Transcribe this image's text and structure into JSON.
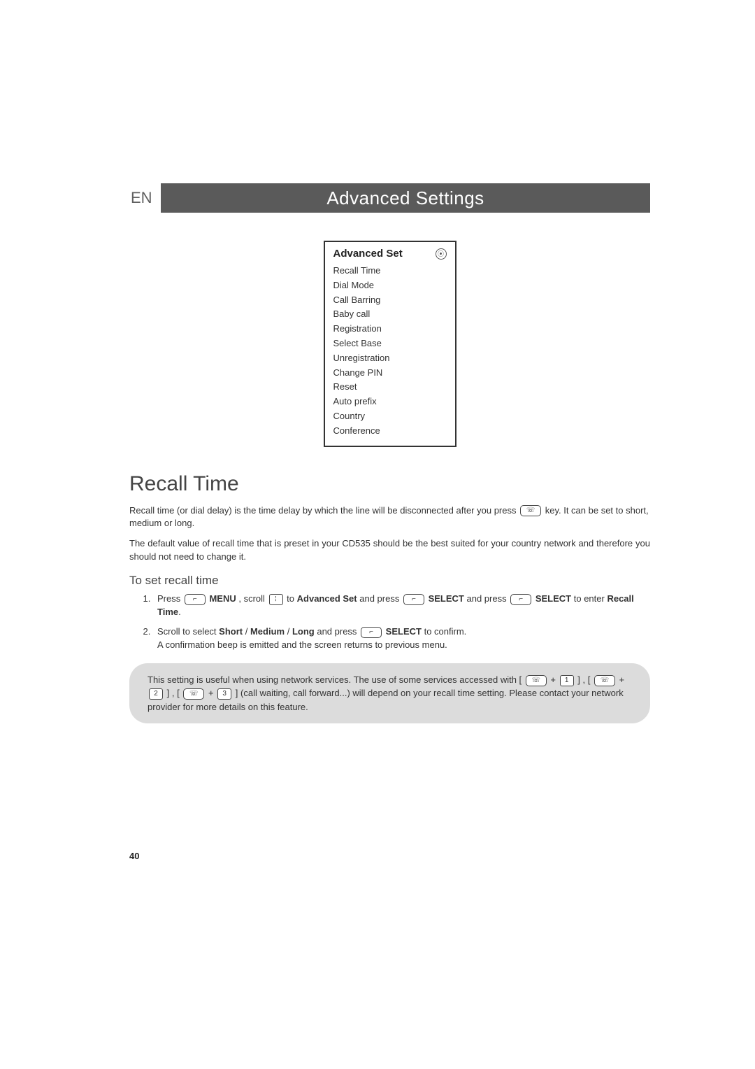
{
  "header": {
    "lang": "EN",
    "title": "Advanced Settings"
  },
  "menu": {
    "title": "Advanced Set",
    "items": [
      "Recall Time",
      "Dial Mode",
      "Call Barring",
      "Baby call",
      "Registration",
      "Select Base",
      "Unregistration",
      "Change PIN",
      "Reset",
      "Auto prefix",
      "Country",
      "Conference"
    ]
  },
  "section": {
    "title": "Recall Time",
    "para1_a": "Recall time (or dial delay) is the time delay by which the line will be disconnected after you press ",
    "para1_b": " key. It can be set to short, medium or long.",
    "para2": "The default value of recall time that is preset in your CD535 should be the best suited for your country network and therefore you should not need to change it."
  },
  "sub": {
    "heading": "To set recall time",
    "step1": {
      "a": "Press ",
      "menu": "MENU",
      "b": ", scroll ",
      "c": " to ",
      "adv": "Advanced Set",
      "d": " and press ",
      "sel1": "SELECT",
      "e": " and press ",
      "sel2": "SELECT",
      "f": " to enter ",
      "recall": "Recall Time",
      "dot": "."
    },
    "step2": {
      "a": "Scroll to select ",
      "s": "Short",
      "slash1": " / ",
      "m": "Medium",
      "slash2": " / ",
      "l": "Long",
      "b": " and press ",
      "sel": "SELECT",
      "c": " to confirm.",
      "d": "A confirmation beep is emitted and the screen returns to previous menu."
    }
  },
  "note": {
    "a": "This setting is useful when using network services. The use of some services accessed with [",
    "b": " + ",
    "c": " ] , [",
    "d": " + ",
    "e": " ] , [",
    "f": " + ",
    "g": " ] (call waiting, call forward...) will depend on your recall time setting. Please contact your network provider for more details on this feature."
  },
  "keys": {
    "phone": "☏",
    "soft": "⌐",
    "nav": "⦙",
    "k1": "1",
    "k2": "2",
    "k3": "3"
  },
  "page_number": "40"
}
